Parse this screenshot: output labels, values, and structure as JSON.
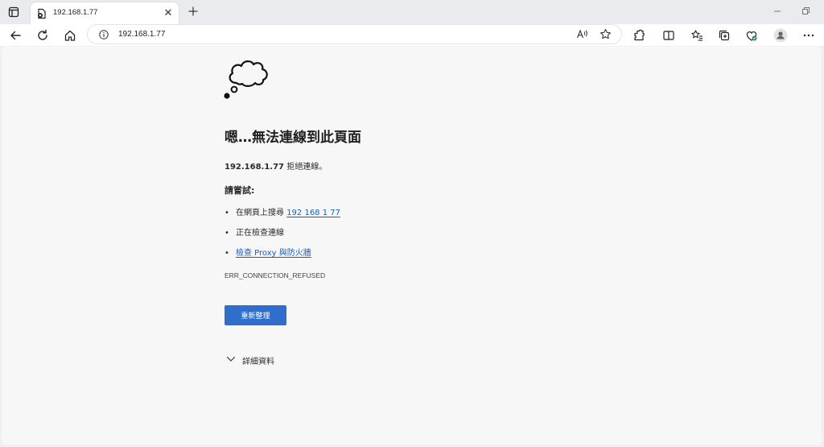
{
  "tab": {
    "title": "192.168.1.77",
    "close_glyph": "✕",
    "new_tab_glyph": "+"
  },
  "address_bar": {
    "url": "192.168.1.77"
  },
  "icons": [
    "tab-actions-icon",
    "page-favicon-icon",
    "back-icon",
    "refresh-icon",
    "home-icon",
    "info-icon",
    "read-aloud-icon",
    "favorite-star-icon",
    "extensions-icon",
    "split-screen-icon",
    "favorites-icon",
    "collections-icon",
    "browser-essentials-icon",
    "profile-icon",
    "more-icon",
    "thought-cloud-icon",
    "chevron-down-icon"
  ],
  "error": {
    "headline": "嗯…無法連線到此頁面",
    "host": "192.168.1.77",
    "refused_suffix": " 拒絕連線。",
    "try_label": "請嘗試:",
    "suggestion1_prefix": "在網頁上搜尋 ",
    "suggestion1_link": "192 168 1 77",
    "suggestion2": "正在檢查連線",
    "suggestion3_link": "檢查 Proxy 與防火牆",
    "bullet": "•",
    "code": "ERR_CONNECTION_REFUSED",
    "reload_label": "重新整理",
    "details_label": "詳細資料"
  },
  "colors": {
    "accent": "#2f6fcb",
    "link": "#1a5fb4",
    "page_bg": "#f7f7f7"
  }
}
